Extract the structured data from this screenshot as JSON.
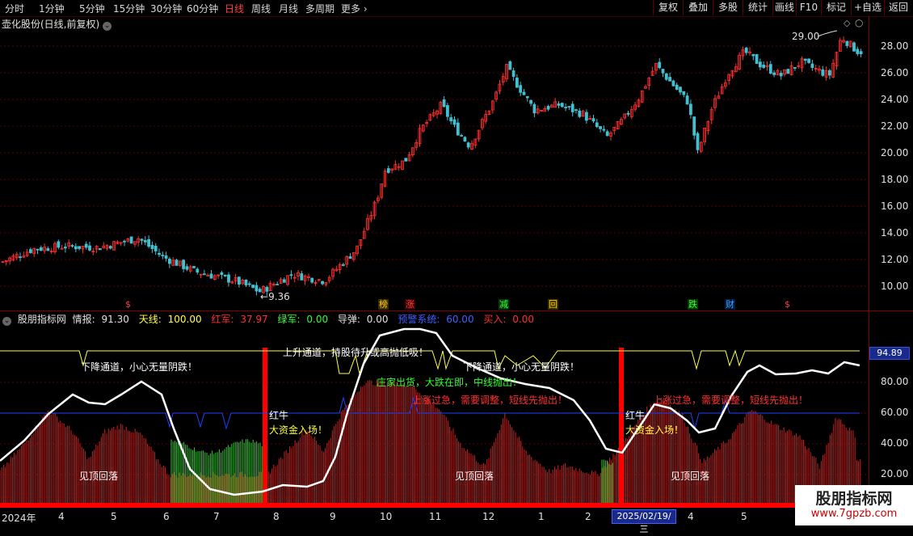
{
  "toolbar": {
    "periods": [
      "分时",
      "1分钟",
      "5分钟",
      "15分钟",
      "30分钟",
      "60分钟",
      "日线",
      "周线",
      "月线",
      "多周期",
      "更多 ›"
    ],
    "active_period": "日线",
    "right_buttons": [
      "复权",
      "叠加",
      "多股",
      "统计",
      "画线",
      "F10",
      "标记",
      "+自选",
      "返回"
    ]
  },
  "main_chart": {
    "title": "壶化股份(日线,前复权)",
    "y_ticks": [
      "28.00",
      "26.00",
      "24.00",
      "22.00",
      "20.00",
      "18.00",
      "16.00",
      "14.00",
      "12.00",
      "10.00"
    ],
    "high_label": "29.00",
    "low_label": "9.36",
    "event_tags": [
      {
        "text": "榜",
        "color": "#ffd000",
        "bg": "#3a2a00"
      },
      {
        "text": "涨",
        "color": "#ff4040",
        "bg": "#3a0000"
      },
      {
        "text": "减",
        "color": "#40ff40",
        "bg": "#003a00"
      },
      {
        "text": "回",
        "color": "#ffd000",
        "bg": "#3a2a00"
      },
      {
        "text": "跌",
        "color": "#40ff40",
        "bg": "#003a00"
      },
      {
        "text": "财",
        "color": "#40a0ff",
        "bg": "#001a3a"
      },
      {
        "text": "$",
        "color": "#ff4040",
        "bg": "#000"
      },
      {
        "text": "$",
        "color": "#ff4040",
        "bg": "#000"
      }
    ]
  },
  "indicator": {
    "name": "股朋指标网",
    "fields": [
      {
        "label": "情报:",
        "value": "91.30",
        "color": "#ffffff"
      },
      {
        "label": "天线:",
        "value": "100.00",
        "color": "#ffff40"
      },
      {
        "label": "红军:",
        "value": "37.97",
        "color": "#ff3030"
      },
      {
        "label": "绿军:",
        "value": "0.00",
        "color": "#30ff30"
      },
      {
        "label": "导弹:",
        "value": "0.00",
        "color": "#e0e0e0"
      },
      {
        "label": "预警系统:",
        "value": "60.00",
        "color": "#4060ff"
      },
      {
        "label": "买入:",
        "value": "0.00",
        "color": "#ff3030"
      }
    ],
    "y_ticks": [
      "80.00",
      "60.00",
      "40.00",
      "20.00"
    ],
    "readout": "94.89",
    "notes": {
      "down_channel_1": "下降通道，小心无量阴跌！",
      "up_channel": "上升通道，持股待升或高抛低吸！",
      "down_channel_2": "下降通道，小心无量阴跌！",
      "shipping": "庄家出货，大跌在即，中线抛出！",
      "overheat_1": "上涨过急，需要调整，短线先抛出！",
      "overheat_2": "上涨过急，需要调整，短线先抛出！",
      "red_bull_1": "红牛",
      "big_money_1": "大资金入场！",
      "red_bull_2": "红牛",
      "big_money_2": "大资金入场！",
      "peak_1": "见顶回落",
      "peak_2": "见顶回落",
      "peak_3": "见顶回落"
    }
  },
  "x_axis": {
    "labels": [
      "2024年",
      "4",
      "5",
      "6",
      "7",
      "8",
      "9",
      "10",
      "11",
      "12",
      "1",
      "2",
      "4",
      "5"
    ],
    "highlight_date": "2025/02/19/三"
  },
  "brand": {
    "name": "股朋指标网",
    "url": "www.7gpzb.com"
  },
  "colors": {
    "up": "#ff3030",
    "down": "#40c0d0",
    "ma_white": "#ffffff",
    "sky_yellow": "#ffff40",
    "warn_blue": "#2040ff"
  }
}
